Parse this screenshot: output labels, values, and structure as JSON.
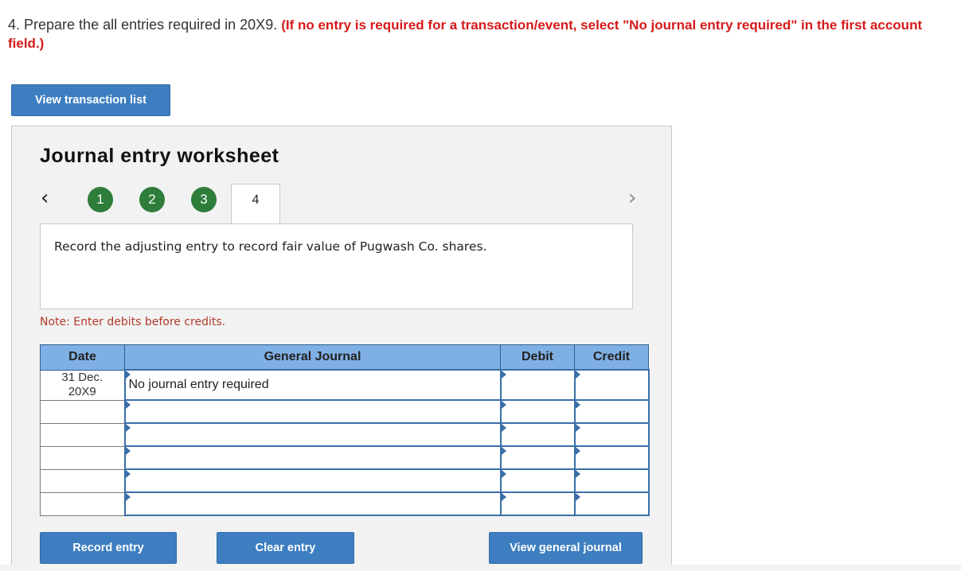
{
  "question": {
    "prefix": "4. Prepare the all entries required in 20X9. ",
    "hint": "(If no entry is required for a transaction/event, select \"No journal entry required\" in the first account field.)"
  },
  "buttons": {
    "view_transactions": "View transaction list",
    "record_entry": "Record entry",
    "clear_entry": "Clear entry",
    "view_general_journal": "View general journal"
  },
  "worksheet": {
    "title": "Journal entry worksheet",
    "steps": [
      "1",
      "2",
      "3"
    ],
    "active_step": "4",
    "description": "Record the adjusting entry to record fair value of Pugwash Co. shares.",
    "note": "Note: Enter debits before credits."
  },
  "icons": {
    "prev": "chevron-left-icon",
    "next": "chevron-right-icon"
  },
  "table": {
    "headers": {
      "date": "Date",
      "journal": "General Journal",
      "debit": "Debit",
      "credit": "Credit"
    },
    "rows": [
      {
        "date": "31 Dec.\n20X9",
        "account": "No journal entry required",
        "debit": "",
        "credit": ""
      },
      {
        "date": "",
        "account": "",
        "debit": "",
        "credit": ""
      },
      {
        "date": "",
        "account": "",
        "debit": "",
        "credit": ""
      },
      {
        "date": "",
        "account": "",
        "debit": "",
        "credit": ""
      },
      {
        "date": "",
        "account": "",
        "debit": "",
        "credit": ""
      },
      {
        "date": "",
        "account": "",
        "debit": "",
        "credit": ""
      }
    ]
  },
  "colors": {
    "button": "#3d7ec0",
    "step_complete": "#2e7d3a",
    "header": "#7fb0e5",
    "hint": "#d61a1a"
  }
}
